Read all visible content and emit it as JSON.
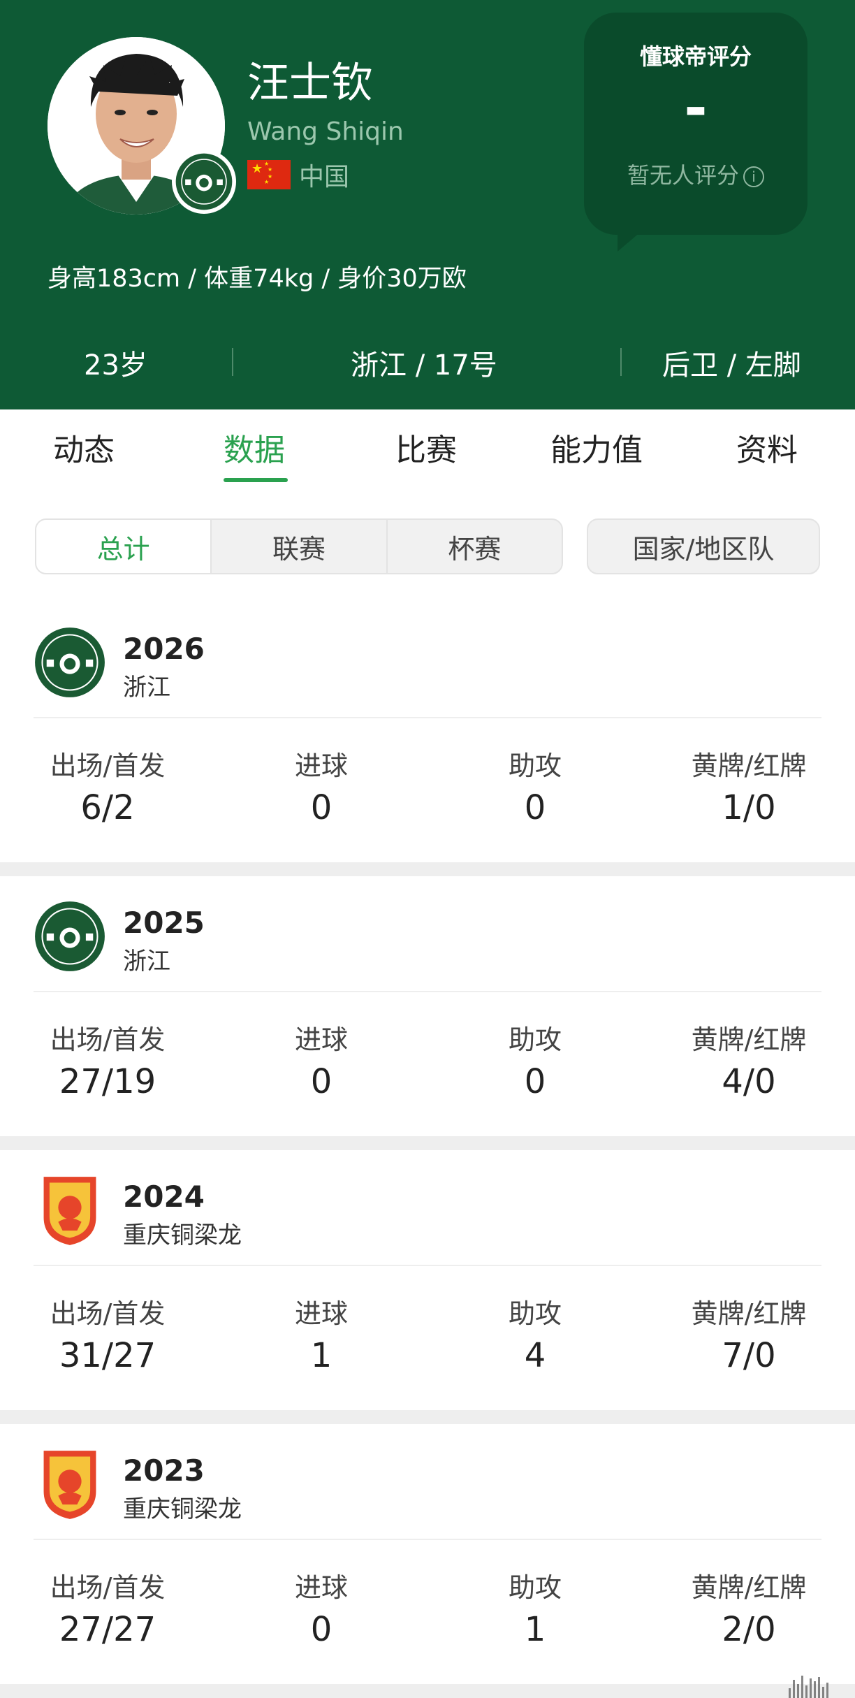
{
  "player": {
    "name_cn": "汪士钦",
    "name_en": "Wang Shiqin",
    "nationality": "中国",
    "body_info": "身高183cm / 体重74kg / 身价30万欧",
    "age": "23岁",
    "club_number": "浙江 / 17号",
    "position_foot": "后卫 / 左脚"
  },
  "rating": {
    "title": "懂球帝评分",
    "value": "-",
    "note": "暂无人评分",
    "info_icon": "info-icon"
  },
  "tabs": [
    {
      "label": "动态",
      "active": false
    },
    {
      "label": "数据",
      "active": true
    },
    {
      "label": "比赛",
      "active": false
    },
    {
      "label": "能力值",
      "active": false
    },
    {
      "label": "资料",
      "active": false
    }
  ],
  "filters": {
    "segments": [
      {
        "label": "总计",
        "active": true
      },
      {
        "label": "联赛",
        "active": false
      },
      {
        "label": "杯赛",
        "active": false
      }
    ],
    "national": "国家/地区队"
  },
  "stat_labels": {
    "apps": "出场/首发",
    "goals": "进球",
    "assists": "助攻",
    "cards": "黄牌/红牌"
  },
  "seasons": [
    {
      "year": "2026",
      "club": "浙江",
      "logo": "zhejiang-logo",
      "apps": "6/2",
      "goals": "0",
      "assists": "0",
      "cards": "1/0"
    },
    {
      "year": "2025",
      "club": "浙江",
      "logo": "zhejiang-logo",
      "apps": "27/19",
      "goals": "0",
      "assists": "0",
      "cards": "4/0"
    },
    {
      "year": "2024",
      "club": "重庆铜梁龙",
      "logo": "chongqing-logo",
      "apps": "31/27",
      "goals": "1",
      "assists": "4",
      "cards": "7/0"
    },
    {
      "year": "2023",
      "club": "重庆铜梁龙",
      "logo": "chongqing-logo",
      "apps": "27/27",
      "goals": "0",
      "assists": "1",
      "cards": "2/0"
    }
  ],
  "colors": {
    "header_bg": "#0e5a35",
    "accent": "#2aa14f",
    "zhejiang": "#1a5a33",
    "chongqing": "#e6452a"
  }
}
